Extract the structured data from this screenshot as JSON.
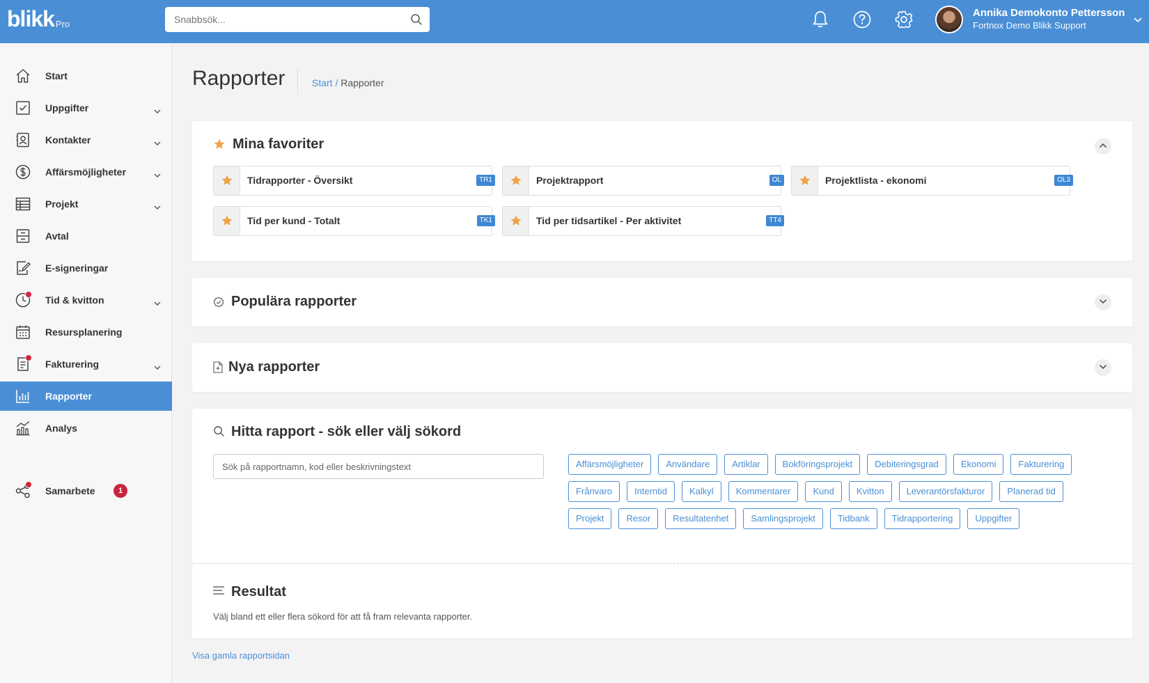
{
  "header": {
    "logo_text": "blikk",
    "logo_sub": "Pro",
    "search_placeholder": "Snabbsök...",
    "user_name": "Annika Demokonto Pettersson",
    "user_org": "Fortnox Demo Blikk Support"
  },
  "sidebar": {
    "items": [
      {
        "label": "Start"
      },
      {
        "label": "Uppgifter"
      },
      {
        "label": "Kontakter"
      },
      {
        "label": "Affärsmöjligheter"
      },
      {
        "label": "Projekt"
      },
      {
        "label": "Avtal"
      },
      {
        "label": "E-signeringar"
      },
      {
        "label": "Tid & kvitton"
      },
      {
        "label": "Resursplanering"
      },
      {
        "label": "Fakturering"
      },
      {
        "label": "Rapporter"
      },
      {
        "label": "Analys"
      },
      {
        "label": "Samarbete",
        "badge": "1"
      }
    ]
  },
  "page": {
    "title": "Rapporter",
    "breadcrumb_link": "Start",
    "breadcrumb_sep": " / ",
    "breadcrumb_current": "Rapporter"
  },
  "favorites": {
    "title": "Mina favoriter",
    "items": [
      {
        "label": "Tidrapporter - Översikt",
        "code": "TR1"
      },
      {
        "label": "Projektrapport",
        "code": "OL"
      },
      {
        "label": "Projektlista - ekonomi",
        "code": "OL3"
      },
      {
        "label": "Tid per kund - Totalt",
        "code": "TK1"
      },
      {
        "label": "Tid per tidsartikel - Per aktivitet",
        "code": "TT4"
      }
    ]
  },
  "popular": {
    "title": "Populära rapporter"
  },
  "new_reports": {
    "title": "Nya rapporter"
  },
  "find": {
    "title": "Hitta rapport - sök eller välj sökord",
    "search_placeholder": "Sök på rapportnamn, kod eller beskrivningstext",
    "tags": [
      "Affärsmöjligheter",
      "Användare",
      "Artiklar",
      "Bokföringsprojekt",
      "Debiteringsgrad",
      "Ekonomi",
      "Fakturering",
      "Frånvaro",
      "Interntid",
      "Kalkyl",
      "Kommentarer",
      "Kund",
      "Kvitton",
      "Leverantörsfakturor",
      "Planerad tid",
      "Projekt",
      "Resor",
      "Resultatenhet",
      "Samlingsprojekt",
      "Tidbank",
      "Tidrapportering",
      "Uppgifter"
    ]
  },
  "result": {
    "title": "Resultat",
    "text": "Välj bland ett eller flera sökord för att få fram relevanta rapporter."
  },
  "footer_link": "Visa gamla rapportsidan",
  "colors": {
    "primary": "#4a8fd6",
    "star": "#f0a245",
    "alert": "#d0263d"
  }
}
